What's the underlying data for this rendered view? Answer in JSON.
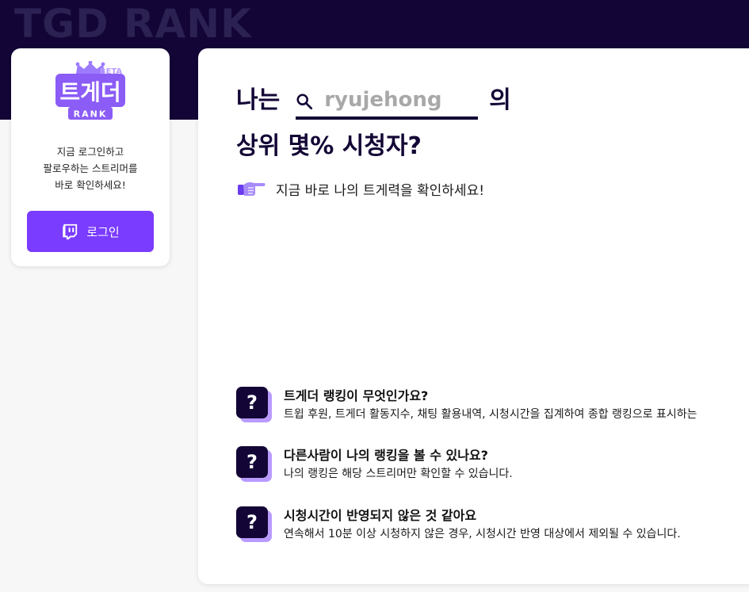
{
  "header": {
    "wordmark": "TGD RANK"
  },
  "login_card": {
    "logo": {
      "badge_text": "BETA",
      "brand_text": "트게더",
      "sub_text": "RANK"
    },
    "message_lines": [
      "지금 로그인하고",
      "팔로우하는 스트리머를",
      "바로 확인하세요!"
    ],
    "login_button_label": "로그인"
  },
  "main": {
    "headline_prefix": "나는",
    "search": {
      "placeholder": "ryujehong",
      "value": ""
    },
    "headline_suffix": "의",
    "headline_line2": "상위 몇% 시청자?",
    "subline": "지금 바로 나의 트게력을 확인하세요!",
    "faq": [
      {
        "title": "트게더 랭킹이 무엇인가요?",
        "desc": "트윕 후원, 트게더 활동지수, 채팅 활용내역, 시청시간을 집계하여 종합 랭킹으로 표시하는"
      },
      {
        "title": "다른사람이 나의 랭킹을 볼 수 있나요?",
        "desc": "나의 랭킹은 해당 스트리머만 확인할 수 있습니다."
      },
      {
        "title": "시청시간이 반영되지 않은 것 같아요",
        "desc": "연속해서 10분 이상 시청하지 않은 경우, 시청시간 반영 대상에서 제외될 수 있습니다."
      }
    ]
  },
  "colors": {
    "navy": "#130535",
    "purple": "#7a3cff",
    "lavender": "#b99bff",
    "logo_purple": "#8b5cf6"
  }
}
